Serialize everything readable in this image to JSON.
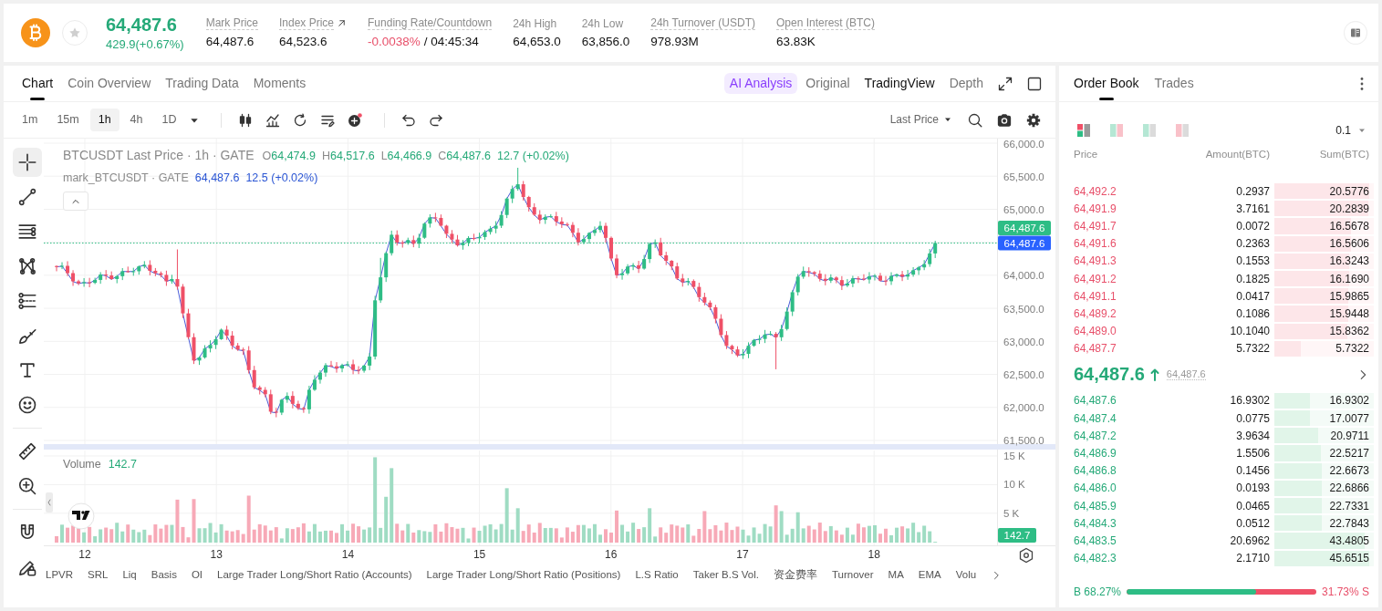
{
  "header": {
    "price": "64,487.6",
    "change": "429.9(+0.67%)",
    "rising": true,
    "favorite": false,
    "stats": [
      {
        "label": "Mark Price",
        "underlined": true,
        "link": false,
        "values": [
          {
            "text": "64,487.6",
            "negative": false
          }
        ]
      },
      {
        "label": "Index Price",
        "underlined": true,
        "link": true,
        "values": [
          {
            "text": "64,523.6",
            "negative": false
          }
        ]
      },
      {
        "label": "Funding Rate/Countdown",
        "underlined": true,
        "link": false,
        "values": [
          {
            "text": "-0.0038%",
            "negative": true
          },
          {
            "text": "/ 04:45:34",
            "negative": false
          }
        ]
      },
      {
        "label": "24h High",
        "underlined": false,
        "link": false,
        "values": [
          {
            "text": "64,653.0",
            "negative": false
          }
        ]
      },
      {
        "label": "24h Low",
        "underlined": false,
        "link": false,
        "values": [
          {
            "text": "63,856.0",
            "negative": false
          }
        ]
      },
      {
        "label": "24h Turnover (USDT)",
        "underlined": true,
        "link": false,
        "values": [
          {
            "text": "978.93M",
            "negative": false
          }
        ]
      },
      {
        "label": "Open Interest (BTC)",
        "underlined": true,
        "link": false,
        "values": [
          {
            "text": "63.83K",
            "negative": false
          }
        ]
      }
    ]
  },
  "chart_panel": {
    "tabs": [
      {
        "label": "Chart",
        "selected": true
      },
      {
        "label": "Coin Overview",
        "selected": false
      },
      {
        "label": "Trading Data",
        "selected": false
      },
      {
        "label": "Moments",
        "selected": false
      }
    ],
    "ai_button": "AI Analysis",
    "views": [
      {
        "label": "Original",
        "selected": false
      },
      {
        "label": "TradingView",
        "selected": true
      },
      {
        "label": "Depth",
        "selected": false
      }
    ],
    "intervals": [
      {
        "label": "1m",
        "selected": false
      },
      {
        "label": "15m",
        "selected": false
      },
      {
        "label": "1h",
        "selected": true
      },
      {
        "label": "4h",
        "selected": false
      },
      {
        "label": "1D",
        "selected": false
      }
    ],
    "price_source": "Last Price",
    "tool_groups": [
      [
        {
          "kind": "crosshair",
          "selected": true
        },
        {
          "kind": "trend_line",
          "selected": false
        },
        {
          "kind": "fib_lines",
          "selected": false
        },
        {
          "kind": "pattern",
          "selected": false
        },
        {
          "kind": "channel",
          "selected": false
        },
        {
          "kind": "brush",
          "selected": false
        },
        {
          "kind": "text",
          "selected": false
        },
        {
          "kind": "emoji",
          "selected": false
        }
      ],
      [
        {
          "kind": "ruler",
          "selected": false
        },
        {
          "kind": "zoom_in",
          "selected": false
        }
      ],
      [
        {
          "kind": "magnet",
          "selected": false
        },
        {
          "kind": "pencil_lock",
          "selected": false
        }
      ]
    ],
    "legend": {
      "title": "BTCUSDT Last Price · 1h · GATE",
      "ohlc": [
        {
          "label": "O",
          "value": "64,474.9"
        },
        {
          "label": "H",
          "value": "64,517.6"
        },
        {
          "label": "L",
          "value": "64,466.9"
        },
        {
          "label": "C",
          "value": "64,487.6"
        }
      ],
      "change": "12.7 (+0.02%)"
    },
    "mark_legend": {
      "title": "mark_BTCUSDT · GATE",
      "value": "64,487.6",
      "change": "12.5 (+0.02%)"
    },
    "price_axis": [
      "66,000.0",
      "65,500.0",
      "65,000.0",
      "64,000.0",
      "63,500.0",
      "63,000.0",
      "62,500.0",
      "62,000.0",
      "61,500.0"
    ],
    "last_price_tag": "64,487.6",
    "mark_price_tag": "64,487.6",
    "volume_legend": {
      "label": "Volume",
      "value": "142.7"
    },
    "volume_axis": [
      "15 K",
      "10 K",
      "5 K"
    ],
    "volume_tag": "142.7",
    "date_axis": [
      "12",
      "13",
      "14",
      "15",
      "16",
      "17",
      "18"
    ],
    "indicators": [
      "LPVR",
      "SRL",
      "Liq",
      "Basis",
      "OI",
      "Large Trader Long/Short Ratio (Accounts)",
      "Large Trader Long/Short Ratio (Positions)",
      "L.S Ratio",
      "Taker B.S Vol.",
      "资金费率",
      "Turnover",
      "MA",
      "EMA",
      "Volu"
    ]
  },
  "order_book": {
    "tabs": [
      {
        "label": "Order Book",
        "selected": true
      },
      {
        "label": "Trades",
        "selected": false
      }
    ],
    "view_modes": [
      {
        "kind": "both",
        "selected": true
      },
      {
        "kind": "split",
        "selected": false
      },
      {
        "kind": "bids",
        "selected": false
      },
      {
        "kind": "asks",
        "selected": false
      }
    ],
    "precision": "0.1",
    "columns": [
      "Price",
      "Amount(BTC)",
      "Sum(BTC)"
    ],
    "asks": [
      {
        "price": "64,492.2",
        "amount": "0.2937",
        "sum": "20.5776",
        "level": 1.0
      },
      {
        "price": "64,491.9",
        "amount": "3.7161",
        "sum": "20.2839",
        "level": 0.986
      },
      {
        "price": "64,491.7",
        "amount": "0.0072",
        "sum": "16.5678",
        "level": 0.805
      },
      {
        "price": "64,491.6",
        "amount": "0.2363",
        "sum": "16.5606",
        "level": 0.805
      },
      {
        "price": "64,491.3",
        "amount": "0.1553",
        "sum": "16.3243",
        "level": 0.793
      },
      {
        "price": "64,491.2",
        "amount": "0.1825",
        "sum": "16.1690",
        "level": 0.786
      },
      {
        "price": "64,491.1",
        "amount": "0.0417",
        "sum": "15.9865",
        "level": 0.777
      },
      {
        "price": "64,489.2",
        "amount": "0.1086",
        "sum": "15.9448",
        "level": 0.775
      },
      {
        "price": "64,489.0",
        "amount": "10.1040",
        "sum": "15.8362",
        "level": 0.77
      },
      {
        "price": "64,487.7",
        "amount": "5.7322",
        "sum": "5.7322",
        "level": 0.279
      }
    ],
    "last_price": "64,487.6",
    "rising": true,
    "mark_price": "64,487.6",
    "bids": [
      {
        "price": "64,487.6",
        "amount": "16.9302",
        "sum": "16.9302",
        "level": 0.371
      },
      {
        "price": "64,487.4",
        "amount": "0.0775",
        "sum": "17.0077",
        "level": 0.373
      },
      {
        "price": "64,487.2",
        "amount": "3.9634",
        "sum": "20.9711",
        "level": 0.459
      },
      {
        "price": "64,486.9",
        "amount": "1.5506",
        "sum": "22.5217",
        "level": 0.493
      },
      {
        "price": "64,486.8",
        "amount": "0.1456",
        "sum": "22.6673",
        "level": 0.497
      },
      {
        "price": "64,486.0",
        "amount": "0.0193",
        "sum": "22.6866",
        "level": 0.497
      },
      {
        "price": "64,485.9",
        "amount": "0.0465",
        "sum": "22.7331",
        "level": 0.498
      },
      {
        "price": "64,484.3",
        "amount": "0.0512",
        "sum": "22.7843",
        "level": 0.499
      },
      {
        "price": "64,483.5",
        "amount": "20.6962",
        "sum": "43.4805",
        "level": 0.952
      },
      {
        "price": "64,482.3",
        "amount": "2.1710",
        "sum": "45.6515",
        "level": 1.0
      }
    ],
    "buy_ratio": {
      "label": "B 68.27%",
      "level": 0.6827
    },
    "sell_ratio": "31.73% S"
  }
}
